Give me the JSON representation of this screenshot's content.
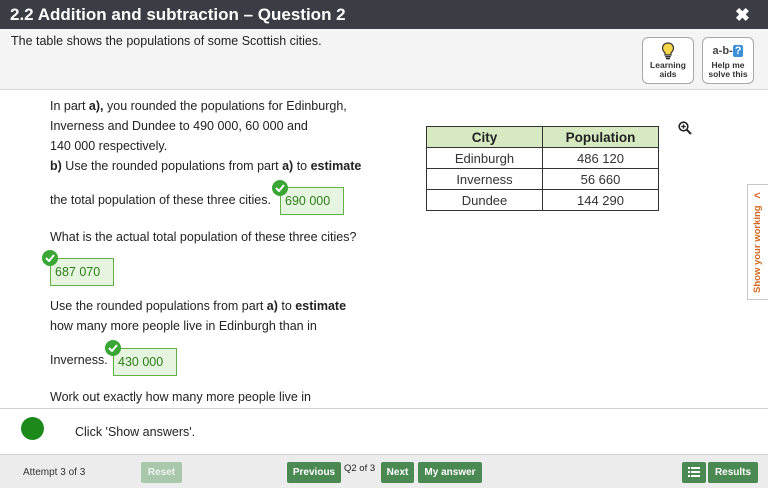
{
  "header": {
    "title": "2.2 Addition and subtraction – Question 2",
    "close_label": "✖"
  },
  "subheader": {
    "intro": "The table shows the populations of some Scottish cities.",
    "learning_aids_label_1": "Learning",
    "learning_aids_label_2": "aids",
    "help_label_1": "Help me",
    "help_label_2": "solve this",
    "help_icon_text": "a-b-",
    "help_icon_q": "?"
  },
  "question": {
    "part_a_intro_1": "In part ",
    "part_a_bold": "a),",
    "part_a_intro_2": " you rounded the populations for Edinburgh,",
    "part_a_line2": "Inverness and Dundee to 490 000, 60 000 and",
    "part_a_line3": "140 000 respectively.",
    "part_b_bold": "b)",
    "part_b_text1": " Use the rounded populations from part ",
    "part_b_bold_a": "a)",
    "part_b_text2": " to ",
    "part_b_estimate": "estimate",
    "q1_text": "the total population of these three cities.",
    "q1_answer": "690 000",
    "q2_text": "What is the actual total population of these three cities?",
    "q2_answer": "687 070",
    "q3_text1": "Use the rounded populations from part ",
    "q3_bold_a": "a)",
    "q3_text2": " to ",
    "q3_estimate": "estimate",
    "q3_line2": "how many more people live in Edinburgh than in",
    "q3_line3": "Inverness.",
    "q3_answer": "430 000",
    "q4_text": "Work out exactly how many more people live in"
  },
  "table": {
    "headers": [
      "City",
      "Population"
    ],
    "rows": [
      [
        "Edinburgh",
        "486 120"
      ],
      [
        "Inverness",
        "56 660"
      ],
      [
        "Dundee",
        "144 290"
      ]
    ]
  },
  "side_tab": {
    "label": "Show your working",
    "chevron": "<"
  },
  "feedback": {
    "message": "Click 'Show answers'."
  },
  "footer": {
    "attempt": "Attempt 3 of 3",
    "reset": "Reset",
    "previous": "Previous",
    "qnum": "Q2 of 3",
    "next": "Next",
    "my_answer": "My answer",
    "results": "Results"
  },
  "colors": {
    "title_bg": "#3a3e44",
    "button_green": "#4a8a52",
    "answer_green": "#63b144",
    "table_header": "#d6e9c0",
    "accent_orange": "#d4671e"
  }
}
